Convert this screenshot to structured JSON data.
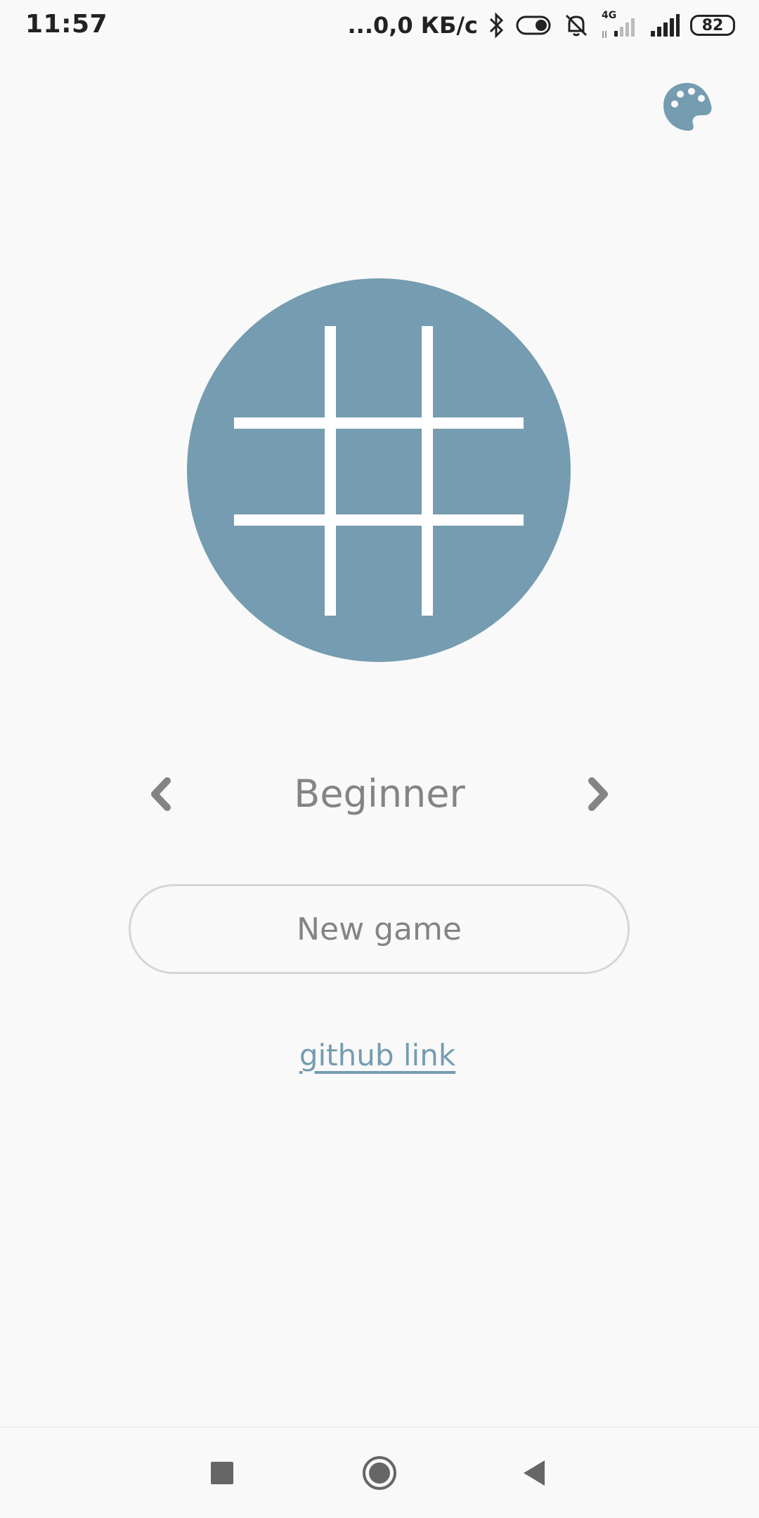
{
  "status_bar": {
    "time": "11:57",
    "network_speed": "...0,0 КБ/с",
    "network_type": "4G",
    "battery_level": "82"
  },
  "icons": {
    "palette": "palette-icon",
    "logo": "tic-tac-toe-grid-icon",
    "prev": "chevron-left-icon",
    "next": "chevron-right-icon",
    "recents": "square-icon",
    "home": "circle-icon",
    "back": "triangle-back-icon"
  },
  "colors": {
    "accent": "#759cb1",
    "text_gray": "#848484",
    "background": "#f9f9f9",
    "button_border": "#d6d6d6"
  },
  "difficulty": {
    "label": "Beginner"
  },
  "actions": {
    "new_game_label": "New game",
    "github_link_label": "github link"
  }
}
